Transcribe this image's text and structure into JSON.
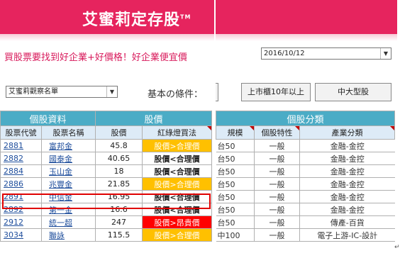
{
  "left": {
    "brand": "艾蜜莉定存股",
    "brand_tm": "TM",
    "slogan": "買股票要找到好企業+好價格！好企業便宜價",
    "watchlist_select": "艾蜜莉觀察名單",
    "criteria_label": "基本の條件：",
    "group_headers": {
      "info": "個股資料",
      "price": "股價"
    },
    "columns": {
      "code": "股票代號",
      "name": "股票名稱",
      "price": "股價",
      "signal": "紅綠燈買法"
    },
    "rows": [
      {
        "code": "2881",
        "name": "富邦金",
        "price": "45.8",
        "signal": "股價>合理價",
        "tone": "yellow"
      },
      {
        "code": "2882",
        "name": "國泰金",
        "price": "40.65",
        "signal": "股價<合理價",
        "tone": "plain"
      },
      {
        "code": "2884",
        "name": "玉山金",
        "price": "18",
        "signal": "股價<合理價",
        "tone": "plain"
      },
      {
        "code": "2886",
        "name": "兆豐金",
        "price": "21.85",
        "signal": "股價>合理價",
        "tone": "yellow"
      },
      {
        "code": "2891",
        "name": "中信金",
        "price": "16.95",
        "signal": "股價<合理價",
        "tone": "plain"
      },
      {
        "code": "2892",
        "name": "第一金",
        "price": "16.6",
        "signal": "股價<合理價",
        "tone": "plain"
      },
      {
        "code": "2912",
        "name": "統一超",
        "price": "247",
        "signal": "股價>昂貴價",
        "tone": "red"
      },
      {
        "code": "3034",
        "name": "聯詠",
        "price": "115.5",
        "signal": "股價>合理價",
        "tone": "yellow"
      }
    ],
    "colors": {
      "banner": "#e6245e",
      "header": "#4bacc6",
      "highlight": "#e00000"
    }
  },
  "right": {
    "date_select": "2016/10/12",
    "buttons": [
      "上市櫃10年以上",
      "中大型股"
    ],
    "group_header": "個股分類",
    "columns": {
      "scale": "規模",
      "trait": "個股特性",
      "industry": "產業分類"
    },
    "rows": [
      {
        "scale": "台50",
        "trait": "一般",
        "industry": "金融-金控"
      },
      {
        "scale": "台50",
        "trait": "一般",
        "industry": "金融-金控"
      },
      {
        "scale": "台50",
        "trait": "一般",
        "industry": "金融-金控"
      },
      {
        "scale": "台50",
        "trait": "一般",
        "industry": "金融-金控"
      },
      {
        "scale": "台50",
        "trait": "一般",
        "industry": "金融-金控"
      },
      {
        "scale": "台50",
        "trait": "一般",
        "industry": "金融-金控"
      },
      {
        "scale": "台50",
        "trait": "一般",
        "industry": "傳產-百貨"
      },
      {
        "scale": "中100",
        "trait": "一般",
        "industry": "電子上游-IC-設計"
      }
    ]
  },
  "enter_mark": "↵"
}
